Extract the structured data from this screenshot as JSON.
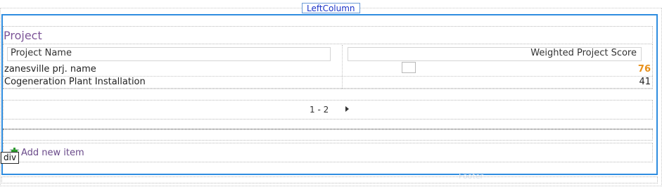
{
  "zone": {
    "tab_label": "LeftColumn",
    "footer_label": "Footer"
  },
  "webpart": {
    "title": "Project",
    "columns": [
      "Project Name",
      "Weighted Project Score"
    ],
    "rows": [
      {
        "name": "zanesville prj. name",
        "score": "76"
      },
      {
        "name": "Cogeneration Plant Installation",
        "score": "41"
      }
    ],
    "highlight_color": "#e8901a",
    "pager": {
      "label": "1 - 2",
      "next_icon": "next-page-arrow-icon"
    },
    "add_link": "Add new item",
    "add_icon": "add-item-icon"
  },
  "designer": {
    "element_tag": "div"
  }
}
